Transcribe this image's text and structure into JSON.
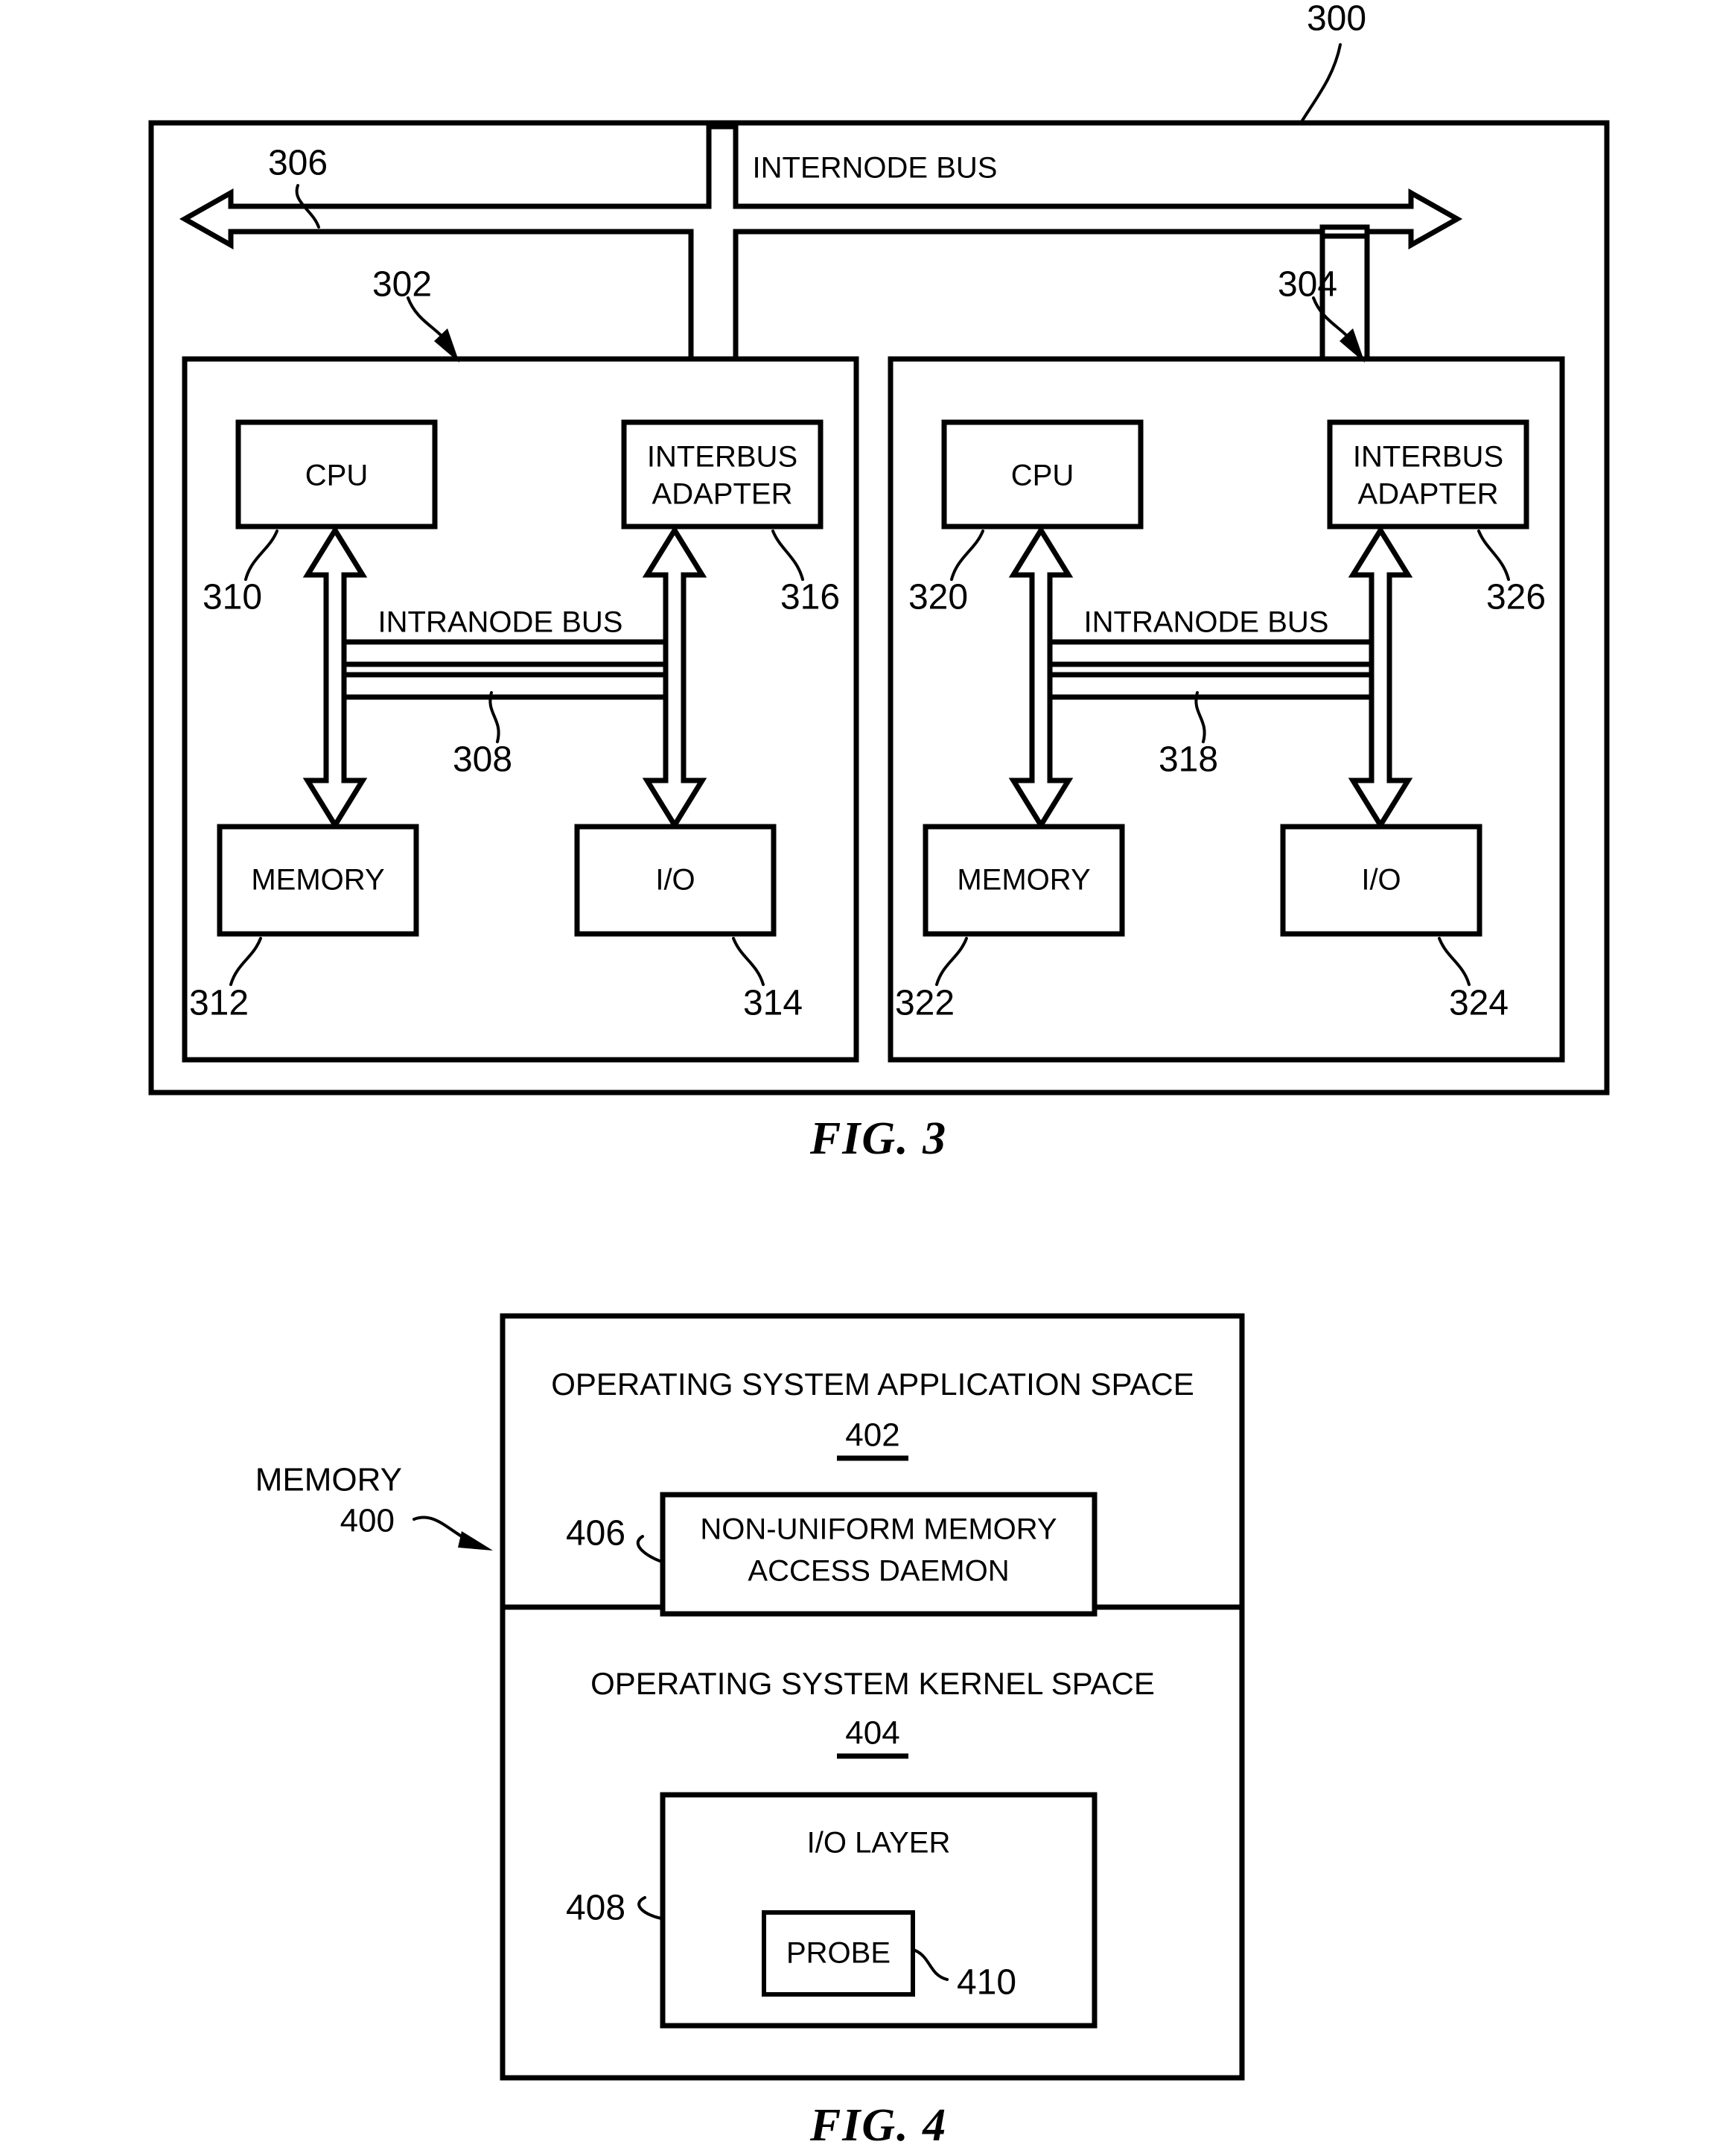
{
  "document": {
    "type": "patent-drawing-sheet",
    "figures": [
      "FIG. 3",
      "FIG. 4"
    ]
  },
  "fig3": {
    "caption": "FIG. 3",
    "system_ref": "300",
    "internode_bus": {
      "label": "INTERNODE BUS",
      "ref": "306"
    },
    "nodes": [
      {
        "ref": "302",
        "intranode_bus": {
          "label": "INTRANODE BUS",
          "ref": "308"
        },
        "components": [
          {
            "label": "CPU",
            "ref": "310"
          },
          {
            "label": "INTERBUS\nADAPTER",
            "line1": "INTERBUS",
            "line2": "ADAPTER",
            "ref": "316"
          },
          {
            "label": "MEMORY",
            "ref": "312"
          },
          {
            "label": "I/O",
            "ref": "314"
          }
        ]
      },
      {
        "ref": "304",
        "intranode_bus": {
          "label": "INTRANODE BUS",
          "ref": "318"
        },
        "components": [
          {
            "label": "CPU",
            "ref": "320"
          },
          {
            "label": "INTERBUS\nADAPTER",
            "line1": "INTERBUS",
            "line2": "ADAPTER",
            "ref": "326"
          },
          {
            "label": "MEMORY",
            "ref": "322"
          },
          {
            "label": "I/O",
            "ref": "324"
          }
        ]
      }
    ]
  },
  "fig4": {
    "caption": "FIG. 4",
    "memory_label_line1": "MEMORY",
    "memory_label_line2": "400",
    "memory_ref": "400",
    "sections": [
      {
        "title": "OPERATING SYSTEM APPLICATION SPACE",
        "ref": "402",
        "child": {
          "line1": "NON-UNIFORM MEMORY",
          "line2": "ACCESS DAEMON",
          "ref": "406"
        }
      },
      {
        "title": "OPERATING SYSTEM KERNEL SPACE",
        "ref": "404",
        "child": {
          "line1": "I/O LAYER",
          "ref": "408",
          "child": {
            "line1": "PROBE",
            "ref": "410"
          }
        }
      }
    ]
  },
  "colors": {
    "ink": "#000000",
    "paper": "#ffffff"
  }
}
